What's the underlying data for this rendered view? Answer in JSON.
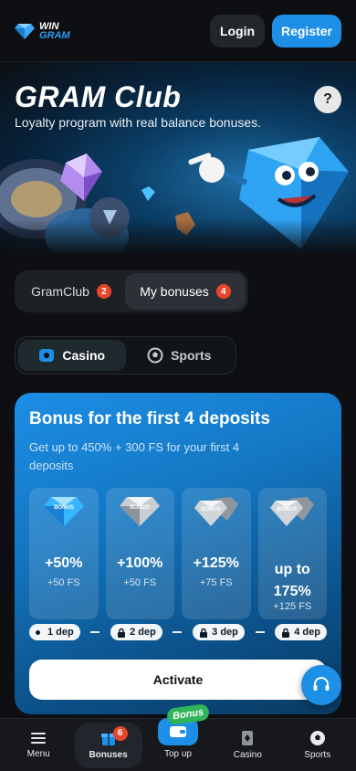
{
  "header": {
    "logo_top": "WIN",
    "logo_bottom": "GRAM",
    "login_label": "Login",
    "register_label": "Register"
  },
  "hero": {
    "title": "GRAM Club",
    "subtitle": "Loyalty program with real balance bonuses.",
    "help_label": "?"
  },
  "tabs": [
    {
      "label": "GramClub",
      "badge": "2",
      "active": false
    },
    {
      "label": "My bonuses",
      "badge": "4",
      "active": true
    }
  ],
  "categories": [
    {
      "label": "Casino",
      "active": true,
      "icon": "casino-icon"
    },
    {
      "label": "Sports",
      "active": false,
      "icon": "soccer-ball-icon"
    }
  ],
  "bonus_card": {
    "title": "Bonus for the first 4 deposits",
    "subtitle": "Get up to 450% + 300 FS for your first 4 deposits",
    "tiles": [
      {
        "percent": "+50%",
        "fs": "+50 FS",
        "gem_label": "BONUS"
      },
      {
        "percent": "+100%",
        "fs": "+50 FS",
        "gem_label": "BONUS"
      },
      {
        "percent": "+125%",
        "fs": "+75 FS",
        "gem_label": "BONUS"
      },
      {
        "percent": "up to 175%",
        "fs": "+125 FS",
        "gem_label": "BONUS"
      }
    ],
    "steps": [
      "1 dep",
      "2 dep",
      "3 dep",
      "4 dep"
    ],
    "activate_label": "Activate"
  },
  "bottom_nav": {
    "items": [
      {
        "label": "Menu",
        "icon": "menu-icon"
      },
      {
        "label": "Bonuses",
        "icon": "gift-icon",
        "badge": "6",
        "active": true
      },
      {
        "label": "Top up",
        "icon": "wallet-icon",
        "tag": "Bonus"
      },
      {
        "label": "Casino",
        "icon": "cards-icon"
      },
      {
        "label": "Sports",
        "icon": "soccer-ball-icon"
      }
    ]
  },
  "colors": {
    "accent": "#1d8fe6",
    "badge": "#e8452c",
    "tag_green": "#2fb45a",
    "background": "#0d0f12"
  }
}
